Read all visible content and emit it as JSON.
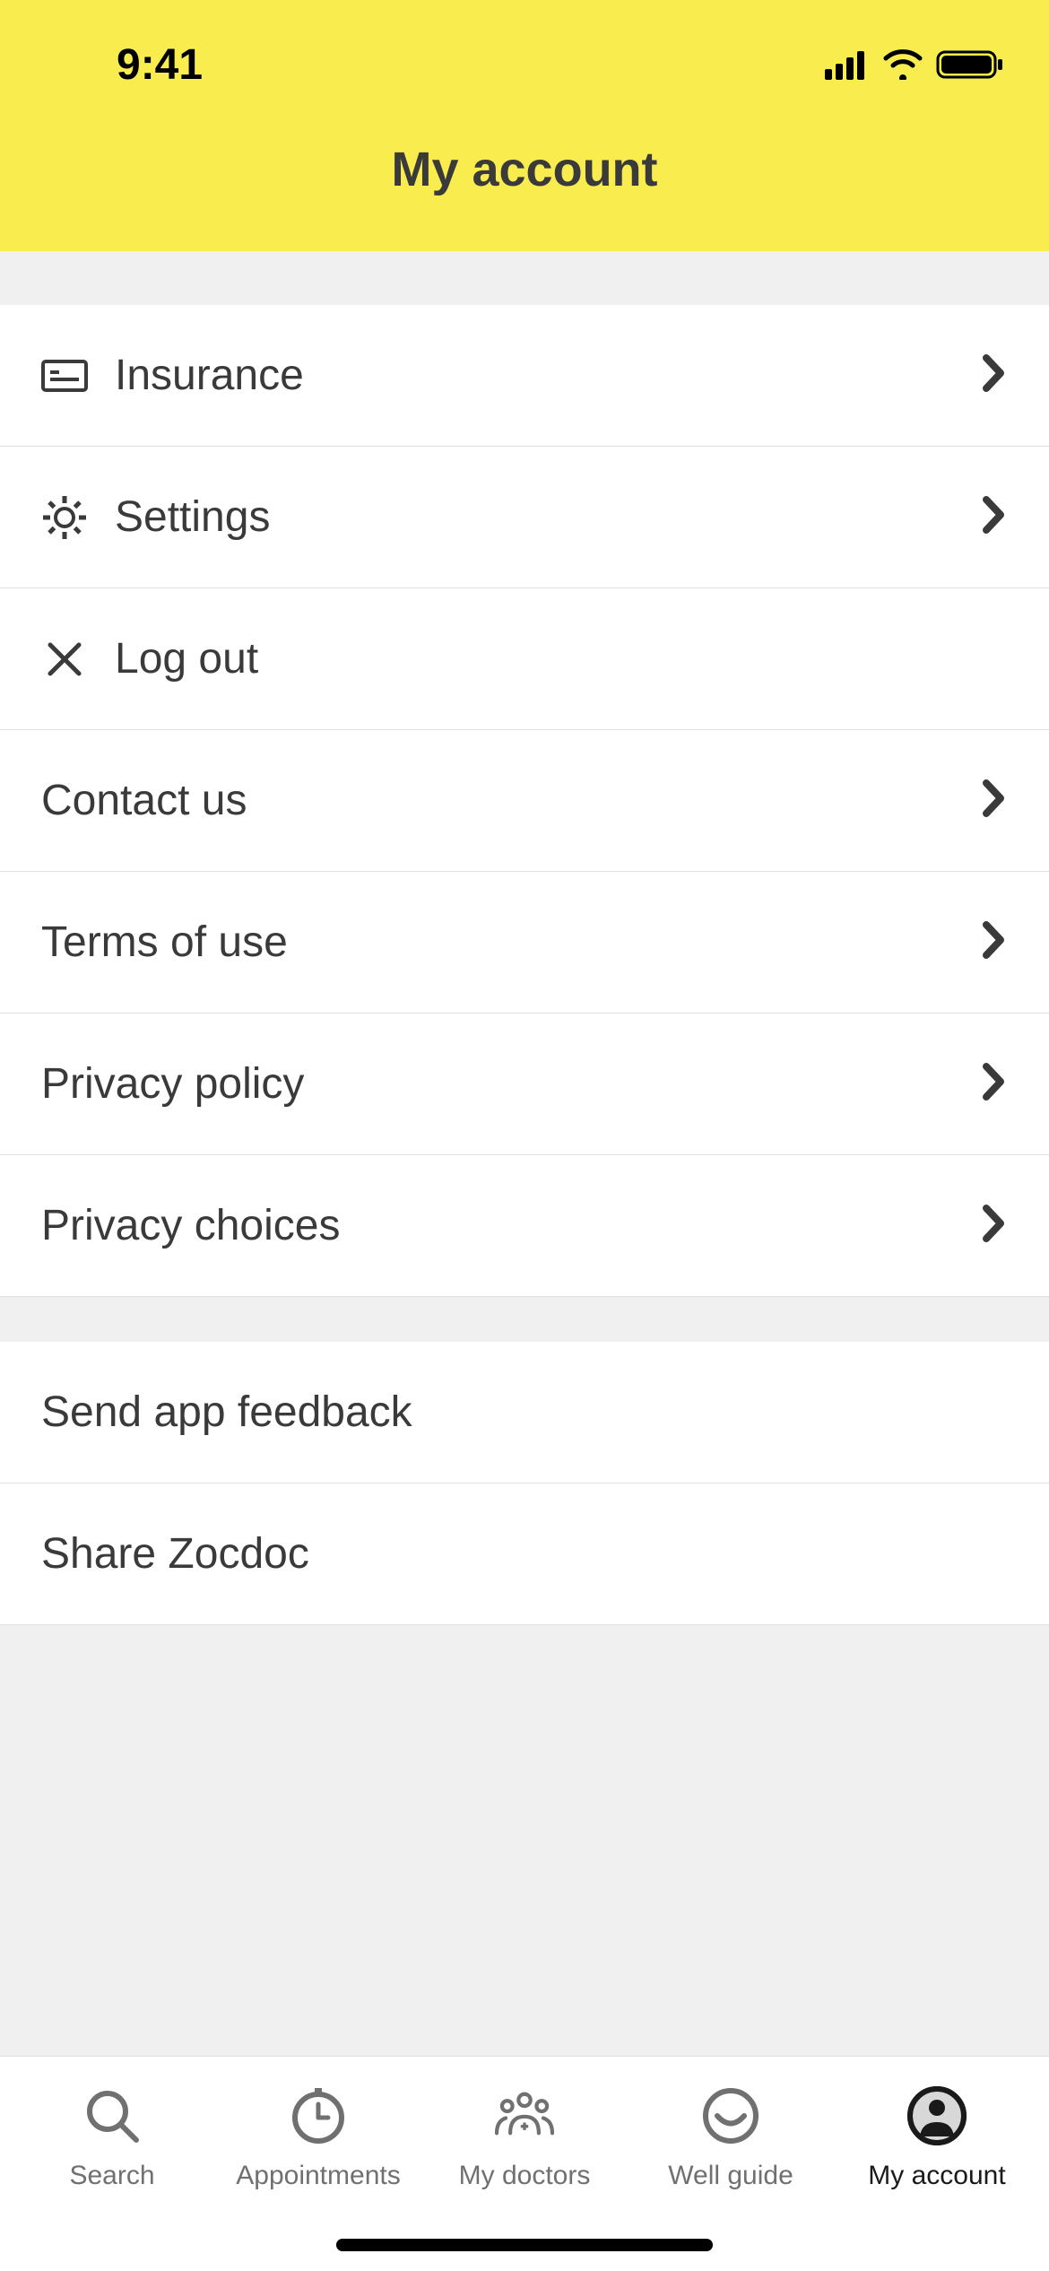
{
  "statusBar": {
    "time": "9:41"
  },
  "header": {
    "title": "My account"
  },
  "menuGroup1": [
    {
      "id": "insurance",
      "label": "Insurance",
      "icon": "card",
      "chevron": true
    },
    {
      "id": "settings",
      "label": "Settings",
      "icon": "gear",
      "chevron": true
    },
    {
      "id": "logout",
      "label": "Log out",
      "icon": "close",
      "chevron": false
    }
  ],
  "menuGroup2": [
    {
      "id": "contact-us",
      "label": "Contact us",
      "chevron": true
    },
    {
      "id": "terms",
      "label": "Terms of use",
      "chevron": true
    },
    {
      "id": "privacy-policy",
      "label": "Privacy policy",
      "chevron": true
    },
    {
      "id": "privacy-choices",
      "label": "Privacy choices",
      "chevron": true
    }
  ],
  "menuGroup3": [
    {
      "id": "feedback",
      "label": "Send app feedback",
      "chevron": false
    },
    {
      "id": "share",
      "label": "Share Zocdoc",
      "chevron": false
    }
  ],
  "tabs": [
    {
      "id": "search",
      "label": "Search",
      "icon": "search",
      "active": false
    },
    {
      "id": "appointments",
      "label": "Appointments",
      "icon": "clock",
      "active": false
    },
    {
      "id": "my-doctors",
      "label": "My doctors",
      "icon": "doctors",
      "active": false
    },
    {
      "id": "well-guide",
      "label": "Well guide",
      "icon": "smile",
      "active": false
    },
    {
      "id": "my-account",
      "label": "My account",
      "icon": "account",
      "active": true
    }
  ]
}
